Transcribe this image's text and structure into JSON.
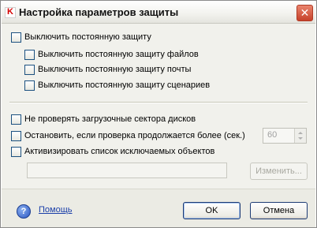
{
  "window": {
    "title": "Настройка параметров защиты",
    "close_label": "✕"
  },
  "options": {
    "disable_protection": "Выключить постоянную защиту",
    "disable_file_protection": "Выключить постоянную защиту файлов",
    "disable_mail_protection": "Выключить постоянную защиту почты",
    "disable_script_protection": "Выключить постоянную защиту сценариев",
    "skip_boot_sectors": "Не проверять загрузочные сектора дисков",
    "stop_if_longer": "Остановить, если проверка продолжается более (сек.)",
    "activate_exclusions": "Активизировать список исключаемых объектов"
  },
  "timeout": {
    "value": "60"
  },
  "exclusions": {
    "value": "",
    "change_label": "Изменить..."
  },
  "footer": {
    "help_icon": "?",
    "help_label": "Помощь",
    "ok_label": "OK",
    "cancel_label": "Отмена"
  },
  "colors": {
    "link": "#1a3ea8",
    "close_button": "#c6412a",
    "checkbox_border": "#1c5180"
  }
}
